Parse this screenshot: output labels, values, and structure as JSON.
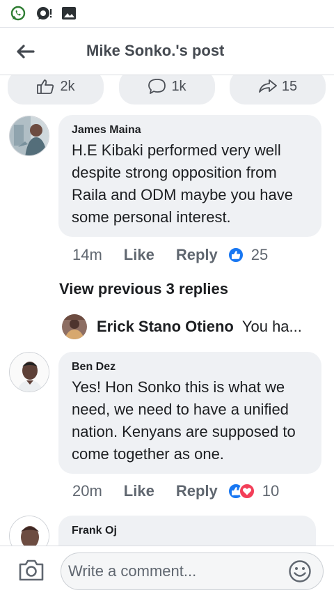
{
  "status_bar": {
    "icons": [
      "whatsapp-icon",
      "chat-bubble-icon",
      "gallery-icon"
    ]
  },
  "header": {
    "title": "Mike Sonko.'s post",
    "back_icon": "arrow-left-icon"
  },
  "post_reactions": {
    "like_count": "2k",
    "comment_count": "1k",
    "share_count": "15"
  },
  "comments": [
    {
      "author": "James Maina",
      "text": "H.E Kibaki performed  very well despite strong opposition from Raila and ODM maybe you have some personal interest.",
      "time": "14m",
      "like_label": "Like",
      "reply_label": "Reply",
      "reaction_count": "25",
      "reactions": [
        "like"
      ],
      "view_previous": "View previous 3 replies",
      "latest_reply": {
        "author": "Erick Stano Otieno",
        "snippet": "You ha..."
      }
    },
    {
      "author": "Ben Dez",
      "text": "Yes! Hon Sonko this is what we need, we need to have a unified nation. Kenyans are supposed to come together as one.",
      "time": "20m",
      "like_label": "Like",
      "reply_label": "Reply",
      "reaction_count": "10",
      "reactions": [
        "like",
        "love"
      ]
    },
    {
      "author": "Frank Oj",
      "text": ""
    }
  ],
  "composer": {
    "placeholder": "Write a comment...",
    "camera_icon": "camera-icon",
    "emoji_icon": "smiley-icon"
  },
  "colors": {
    "accent_blue": "#1877f2",
    "love_red": "#f33e58",
    "bubble_bg": "#eff1f4",
    "secondary_text": "#606770"
  }
}
